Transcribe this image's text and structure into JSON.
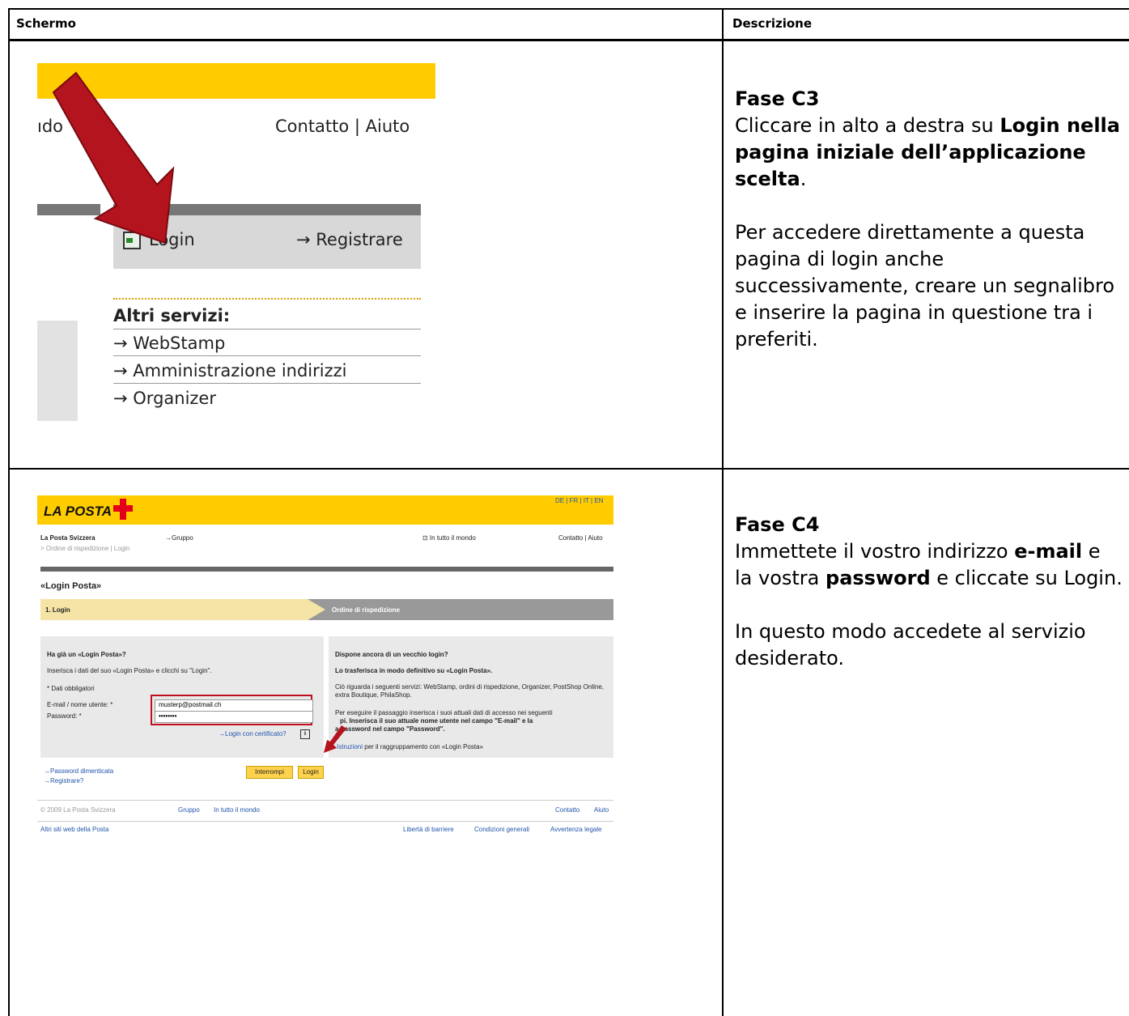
{
  "table": {
    "header_left": "Schermo",
    "header_right": "Descrizione"
  },
  "row1": {
    "phase": "Fase C3",
    "text_before": "Cliccare in alto a destra su ",
    "text_bold": "Login nella pagina iniziale dell’applicazione scelta",
    "text_after": ".",
    "paragraph": "Per accedere direttamente a questa pagina di login anche successivamente, creare un segnalibro e inserire la pagina in questione tra i preferiti.",
    "screenshot": {
      "partial_word": "ıdo",
      "contact_help": "Contatto | Aiuto",
      "login": "Login",
      "register": "→ Registrare",
      "other_services": "Altri servizi:",
      "services": [
        "→ WebStamp",
        "→ Amministrazione indirizzi",
        "→ Organizer"
      ]
    }
  },
  "row2": {
    "phase": "Fase C4",
    "p1_a": "Immettete il vostro indirizzo ",
    "p1_b": "e-mail",
    "p1_c": " e la vostra ",
    "p1_d": "password",
    "p1_e": " e cliccate su Login.",
    "p2": "In questo modo accedete al servizio desiderato.",
    "screenshot": {
      "brand": "LA POSTA",
      "languages": "DE | FR | IT | EN",
      "site_name": "La Posta Svizzera",
      "group": "→Gruppo",
      "worldwide": "⊡ In tutto il mondo",
      "contact": "Contatto | Aiuto",
      "breadcrumb": "> Ordine di rispedizione | Login",
      "page_title": "«Login Posta»",
      "step1": "1. Login",
      "step2": "Ordine di rispedizione",
      "left_heading": "Ha già un «Login Posta»?",
      "left_intro": "Inserisca i dati del suo «Login Posta» e clicchi su \"Login\".",
      "required": "* Dati obbligatori",
      "email_label": "E-mail / nome utente: *",
      "email_value": "musterp@postmail.ch",
      "password_label": "Password: *",
      "password_value": "••••••••",
      "cert_login": "→Login con certificato?",
      "right_heading": "Dispone ancora di un vecchio login?",
      "right_sub": "Lo trasferisca in modo definitivo su «Login Posta».",
      "right_p1": "Ciò riguarda i seguenti servizi: WebStamp, ordini di rispedizione, Organizer, PostShop Online, extra Boutique, PhilaShop.",
      "right_p2a": "Per eseguire il passaggio inserisca i suoi attuali dati di accesso nei seguenti",
      "right_p2b": "pi. Inserisca il suo attuale nome utente nel campo \"E-mail\" e la",
      "right_p2c": "a password nel campo \"Password\".",
      "instructions_link": "Istruzioni",
      "instructions_rest": " per il raggruppamento con «Login Posta»",
      "forgot": "→Password dimenticata",
      "register": "→Registrare?",
      "cancel_btn": "Interrompi",
      "login_btn": "Login",
      "copyright": "© 2009 La Posta Svizzera",
      "foot_group": "Gruppo",
      "foot_world": "In tutto il mondo",
      "foot_contact": "Contatto",
      "foot_help": "Aiuto",
      "other_sites": "Altri siti web della Posta",
      "foot_links": [
        "Libertà di barriere",
        "Condizioni generali",
        "Avvertenza legale"
      ]
    }
  }
}
